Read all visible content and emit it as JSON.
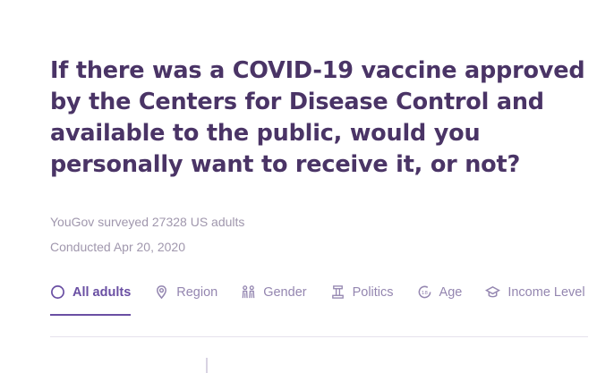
{
  "question": "If there was a COVID-19 vaccine approved by the Centers for Disease Control and available to the public, would you personally want to receive it, or not?",
  "survey_info": "YouGov surveyed 27328 US adults",
  "conducted": "Conducted Apr 20, 2020",
  "tabs": [
    {
      "label": "All adults",
      "icon": "circle-icon",
      "active": true
    },
    {
      "label": "Region",
      "icon": "map-pin-icon",
      "active": false
    },
    {
      "label": "Gender",
      "icon": "gender-icon",
      "active": false
    },
    {
      "label": "Politics",
      "icon": "politics-icon",
      "active": false
    },
    {
      "label": "Age",
      "icon": "age-icon",
      "active": false
    },
    {
      "label": "Income Level",
      "icon": "income-icon",
      "active": false
    }
  ],
  "colors": {
    "title": "#4a3466",
    "accent": "#6a4fa3",
    "muted": "#a097ad",
    "tab_inactive": "#9486b0"
  }
}
